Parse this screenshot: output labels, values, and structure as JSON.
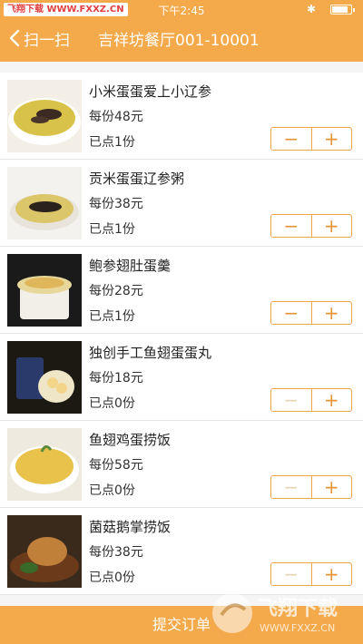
{
  "status_bar": {
    "left_badge": "飞翔下载 WWW.FXXZ.CN",
    "time": "下午2:45",
    "bluetooth": "✱",
    "battery_level": 0.85
  },
  "nav": {
    "back_label": "扫一扫",
    "title": "吉祥坊餐厅001-10001"
  },
  "items": [
    {
      "name": "小米蛋蛋爱上小辽参",
      "price": "每份48元",
      "count": "已点1份"
    },
    {
      "name": "贡米蛋蛋辽参粥",
      "price": "每份38元",
      "count": "已点1份"
    },
    {
      "name": "鲍参翅肚蛋羹",
      "price": "每份28元",
      "count": "已点1份"
    },
    {
      "name": "独创手工鱼翅蛋蛋丸",
      "price": "每份18元",
      "count": "已点0份"
    },
    {
      "name": "鱼翅鸡蛋捞饭",
      "price": "每份58元",
      "count": "已点0份"
    },
    {
      "name": "菌菇鹅掌捞饭",
      "price": "每份38元",
      "count": "已点0份"
    }
  ],
  "stepper": {
    "minus": "−",
    "plus": "+"
  },
  "submit": {
    "label": "提交订单"
  },
  "watermark": {
    "text_cn": "飞翔下载",
    "text_url": "WWW.FXXZ.CN"
  },
  "colors": {
    "accent": "#f4a94a",
    "stepper_border": "#f0a64a"
  }
}
